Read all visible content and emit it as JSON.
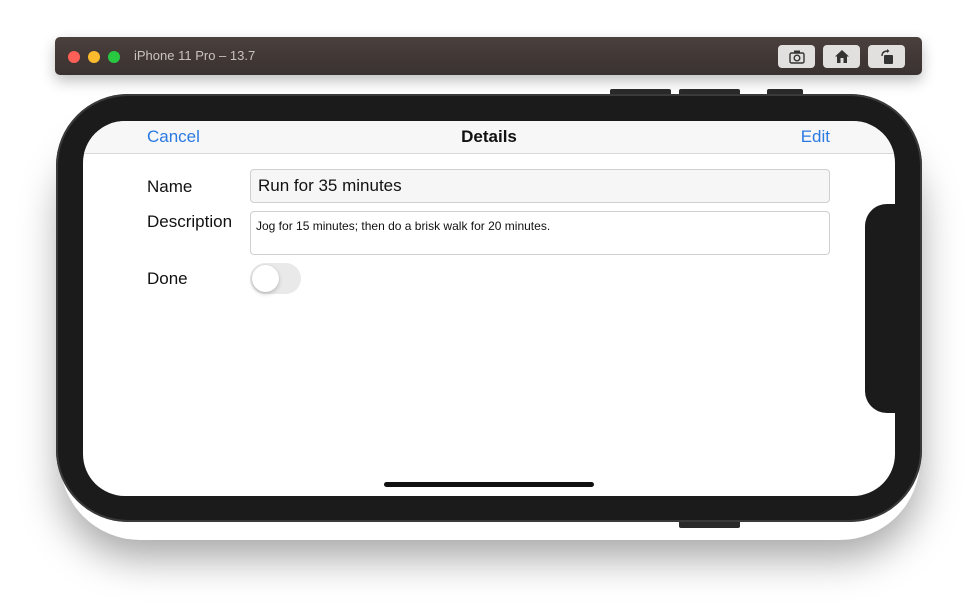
{
  "window": {
    "title": "iPhone 11 Pro – 13.7",
    "toolbar": {
      "screenshot_icon": "camera-icon",
      "home_icon": "home-icon",
      "rotate_icon": "rotate-icon"
    }
  },
  "navbar": {
    "cancel_label": "Cancel",
    "title": "Details",
    "edit_label": "Edit"
  },
  "form": {
    "name_label": "Name",
    "name_value": "Run for 35 minutes",
    "description_label": "Description",
    "description_value": "Jog for 15 minutes; then do a brisk walk for 20 minutes.",
    "done_label": "Done",
    "done_value": false
  },
  "colors": {
    "accent": "#2a7ae2",
    "toggle_off": "#e9e9ea"
  }
}
